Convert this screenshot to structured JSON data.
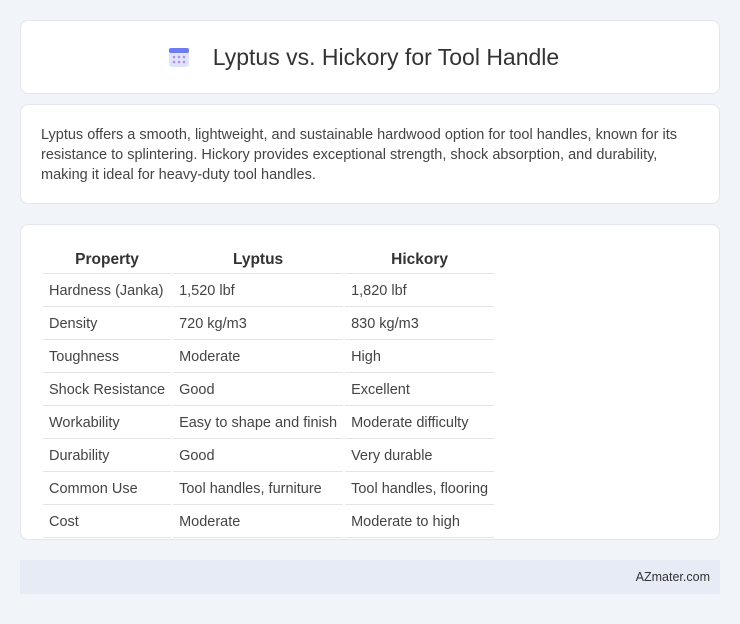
{
  "header": {
    "title": "Lyptus vs. Hickory for Tool Handle",
    "icon": "calendar-icon"
  },
  "intro": {
    "text": "Lyptus offers a smooth, lightweight, and sustainable hardwood option for tool handles, known for its resistance to splintering. Hickory provides exceptional strength, shock absorption, and durability, making it ideal for heavy-duty tool handles."
  },
  "table": {
    "headers": [
      "Property",
      "Lyptus",
      "Hickory"
    ],
    "rows": [
      [
        "Hardness (Janka)",
        "1,520 lbf",
        "1,820 lbf"
      ],
      [
        "Density",
        "720 kg/m3",
        "830 kg/m3"
      ],
      [
        "Toughness",
        "Moderate",
        "High"
      ],
      [
        "Shock Resistance",
        "Good",
        "Excellent"
      ],
      [
        "Workability",
        "Easy to shape and finish",
        "Moderate difficulty"
      ],
      [
        "Durability",
        "Good",
        "Very durable"
      ],
      [
        "Common Use",
        "Tool handles, furniture",
        "Tool handles, flooring"
      ],
      [
        "Cost",
        "Moderate",
        "Moderate to high"
      ]
    ]
  },
  "footer": {
    "text": "AZmater.com"
  }
}
